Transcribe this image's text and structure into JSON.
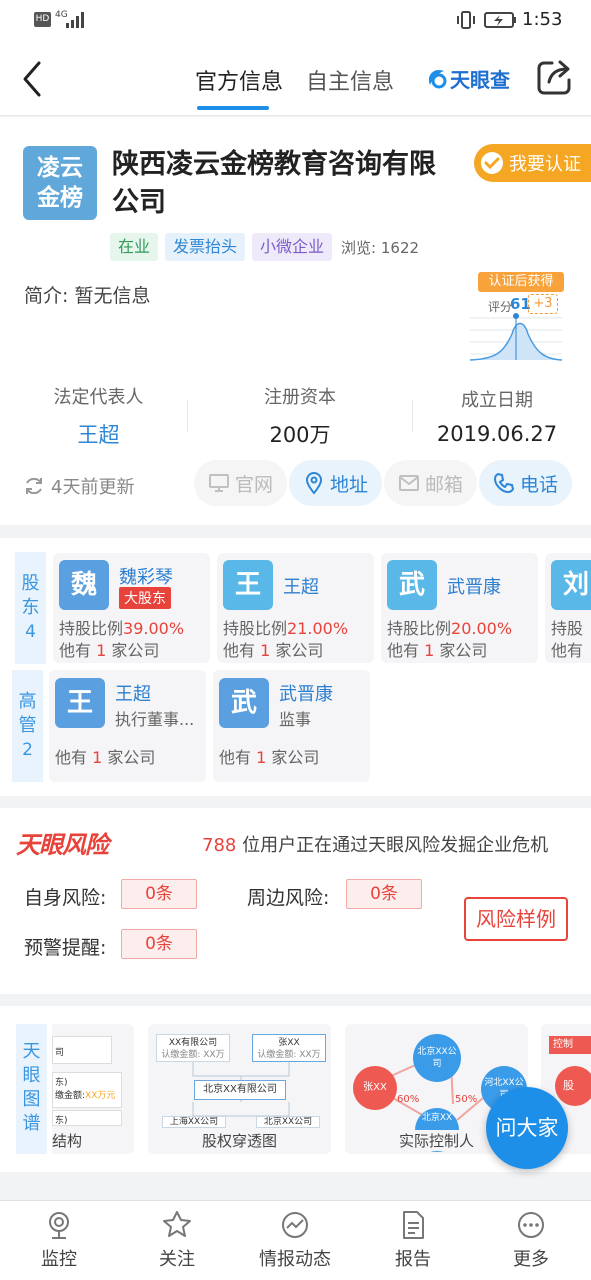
{
  "status": {
    "net": "HD",
    "signal_gen": "4G",
    "time": "1:53"
  },
  "nav": {
    "tabs": [
      {
        "label": "官方信息"
      },
      {
        "label": "自主信息"
      }
    ],
    "brand": "天眼查"
  },
  "company": {
    "logo_text": "凌云金榜",
    "logo_line1": "凌云",
    "logo_line2": "金榜",
    "name": "陕西凌云金榜教育咨询有限公司",
    "verify_label": "我要认证",
    "tags": [
      {
        "label": "在业",
        "color": "#2f9a5a",
        "bg": "#e6f6ec"
      },
      {
        "label": "发票抬头",
        "color": "#2d86d6",
        "bg": "#e6f1fb"
      },
      {
        "label": "小微企业",
        "color": "#7b5cc9",
        "bg": "#efeafa"
      }
    ],
    "views": "浏览: 1622",
    "intro": "简介: 暂无信息",
    "score_banner": "认证后获得",
    "score_label": "评分",
    "score_value": "61",
    "score_bonus": "+3",
    "stats": [
      {
        "label": "法定代表人",
        "value": "王超"
      },
      {
        "label": "注册资本",
        "value": "200万"
      },
      {
        "label": "成立日期",
        "value": "2019.06.27"
      }
    ],
    "updated": "4天前更新",
    "actions": [
      {
        "label": "官网",
        "enabled": false
      },
      {
        "label": "地址",
        "enabled": true
      },
      {
        "label": "邮箱",
        "enabled": false
      },
      {
        "label": "电话",
        "enabled": true
      }
    ]
  },
  "shareholders": {
    "label_chars": [
      "股",
      "东"
    ],
    "count": "4",
    "items": [
      {
        "avatar": "魏",
        "name": "魏彩琴",
        "badge": "大股东",
        "ratio_label": "持股比例",
        "ratio": "39.00%",
        "other_pre": "他有",
        "other_num": "1",
        "other_post": "家公司",
        "color": "#5aa0e0"
      },
      {
        "avatar": "王",
        "name": "王超",
        "ratio_label": "持股比例",
        "ratio": "21.00%",
        "other_pre": "他有",
        "other_num": "1",
        "other_post": "家公司",
        "color": "#5ab8e8"
      },
      {
        "avatar": "武",
        "name": "武晋康",
        "ratio_label": "持股比例",
        "ratio": "20.00%",
        "other_pre": "他有",
        "other_num": "1",
        "other_post": "家公司",
        "color": "#5ab8e8"
      },
      {
        "avatar": "刘",
        "ratio_label": "持股",
        "other_pre": "他有",
        "color": "#5ab8e8"
      }
    ]
  },
  "executives": {
    "label_chars": [
      "高",
      "管"
    ],
    "count": "2",
    "items": [
      {
        "avatar": "王",
        "name": "王超",
        "role": "执行董事...",
        "other_pre": "他有",
        "other_num": "1",
        "other_post": "家公司",
        "color": "#5aa0e0"
      },
      {
        "avatar": "武",
        "name": "武晋康",
        "role": "监事",
        "other_pre": "他有",
        "other_num": "1",
        "other_post": "家公司",
        "color": "#5aa0e0"
      }
    ]
  },
  "risk": {
    "logo": "天眼风险",
    "users_count": "788",
    "users_text": "位用户正在通过天眼风险发掘企业危机",
    "self_label": "自身风险:",
    "self_value": "0条",
    "around_label": "周边风险:",
    "around_value": "0条",
    "warn_label": "预警提醒:",
    "warn_value": "0条",
    "sample_button": "风险样例"
  },
  "graph": {
    "label_chars": [
      "天",
      "眼",
      "图",
      "谱"
    ],
    "cards": [
      {
        "title": "结构",
        "lines": [
          "司",
          "东)",
          "缴金额:",
          "XX万元",
          "东)"
        ]
      },
      {
        "title": "股权穿透图",
        "box1": "XX有限公司",
        "box1_sub": "认缴金额: XX万",
        "box2": "张XX",
        "box2_sub": "认缴金额: XX万",
        "center": "北京XX有限公司",
        "b1": "上海XX公司",
        "b2": "北京XX公司"
      },
      {
        "title": "实际控制人",
        "n1": "北京XX公司",
        "n2": "张XX",
        "n3": "河北XX公司",
        "n4": "北京XX",
        "p1": "60%",
        "p2": "50%"
      },
      {
        "title": "",
        "tag": "控制",
        "mini": "股"
      }
    ],
    "ask_button": "问大家"
  },
  "bottom_nav": [
    {
      "label": "监控",
      "icon": "monitor-icon"
    },
    {
      "label": "关注",
      "icon": "star-icon"
    },
    {
      "label": "情报动态",
      "icon": "trend-icon"
    },
    {
      "label": "报告",
      "icon": "report-icon"
    },
    {
      "label": "更多",
      "icon": "more-icon"
    }
  ]
}
